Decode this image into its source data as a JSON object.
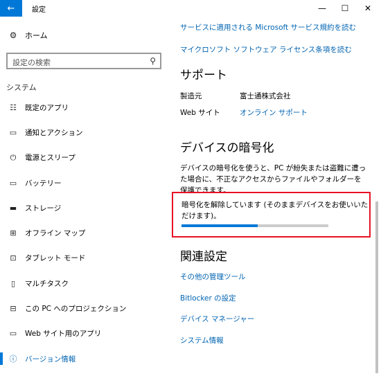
{
  "window": {
    "title": "設定",
    "back_icon": "←",
    "min_icon": "—",
    "max_icon": "☐",
    "close_icon": "✕"
  },
  "sidebar": {
    "home": {
      "icon": "⚙",
      "label": "ホーム"
    },
    "search": {
      "placeholder": "設定の検索",
      "icon": "⚲"
    },
    "section": "システム",
    "items": [
      {
        "icon": "☷",
        "label": "既定のアプリ",
        "active": false
      },
      {
        "icon": "▭",
        "label": "通知とアクション",
        "active": false
      },
      {
        "icon": "⏻",
        "label": "電源とスリープ",
        "active": false
      },
      {
        "icon": "▭",
        "label": "バッテリー",
        "active": false
      },
      {
        "icon": "▬",
        "label": "ストレージ",
        "active": false
      },
      {
        "icon": "⊞",
        "label": "オフライン マップ",
        "active": false
      },
      {
        "icon": "⊡",
        "label": "タブレット モード",
        "active": false
      },
      {
        "icon": "▯",
        "label": "マルチタスク",
        "active": false
      },
      {
        "icon": "⊟",
        "label": "この PC へのプロジェクション",
        "active": false
      },
      {
        "icon": "▭",
        "label": "Web サイト用のアプリ",
        "active": false
      },
      {
        "icon": "ⓘ",
        "label": "バージョン情報",
        "active": true
      }
    ]
  },
  "main": {
    "top_links": [
      "サービスに適用される Microsoft サービス規約を読む",
      "マイクロソフト ソフトウェア ライセンス条項を読む"
    ],
    "support": {
      "heading": "サポート",
      "manufacturer_label": "製造元",
      "manufacturer_value": "富士通株式会社",
      "website_label": "Web サイト",
      "website_value": "オンライン サポート"
    },
    "encryption": {
      "heading": "デバイスの暗号化",
      "description": "デバイスの暗号化を使うと、PC が紛失または盗難に遭った場合に、不正なアクセスからファイルやフォルダーを保護できます。",
      "status": "暗号化を解除しています (そのままデバイスをお使いいただけます)。",
      "progress": 0.52
    },
    "related": {
      "heading": "関連設定",
      "links": [
        "その他の管理ツール",
        "Bitlocker の設定",
        "デバイス マネージャー",
        "システム情報"
      ]
    }
  },
  "colors": {
    "accent": "#0078d7",
    "link": "#0063b1",
    "highlight_border": "#e81123"
  }
}
